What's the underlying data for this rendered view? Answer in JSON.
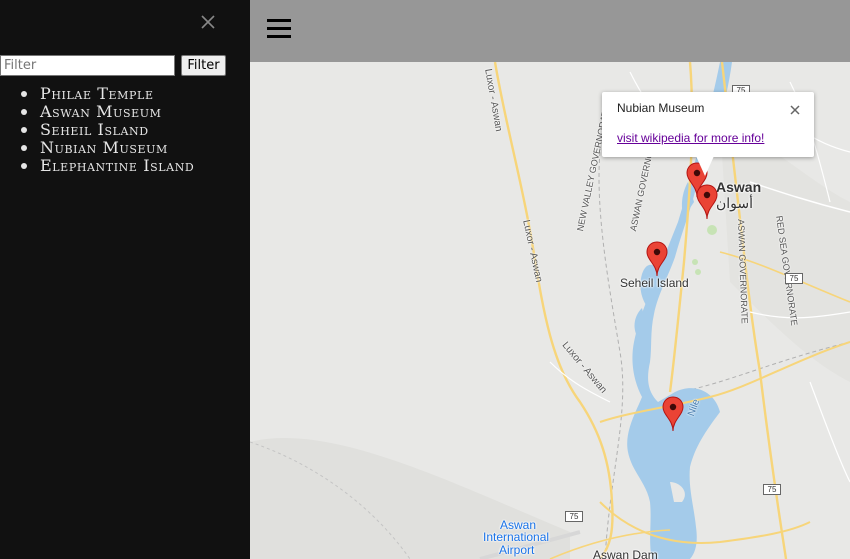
{
  "sidebar": {
    "filter": {
      "placeholder": "Filter",
      "value": ""
    },
    "filter_button": "Filter",
    "places": [
      "Philae Temple",
      "Aswan Museum",
      "Seheil Island",
      "Nubian Museum",
      "Elephantine Island"
    ]
  },
  "info_window": {
    "title": "Nubian Museum",
    "link": "visit wikipedia for more info!"
  },
  "map": {
    "labels": {
      "city_en": "Aswan",
      "city_ar": "أسوان",
      "seheil": "Seheil Island",
      "airport_line1": "Aswan",
      "airport_line2": "International",
      "airport_line3": "Airport",
      "dam": "Aswan Dam",
      "nile": "Nile"
    },
    "roads": {
      "luxor_aswan": "Luxor - Aswan",
      "new_valley": "NEW VALLEY GOVERNORATE",
      "aswan_gov": "ASWAN GOVERNORATE",
      "red_sea": "RED SEA GOVERNORATE",
      "route": "75"
    },
    "colors": {
      "water": "#a4cbea",
      "road": "#f7d57a",
      "land": "#e8e8e6",
      "marker": "#ea4335"
    }
  }
}
